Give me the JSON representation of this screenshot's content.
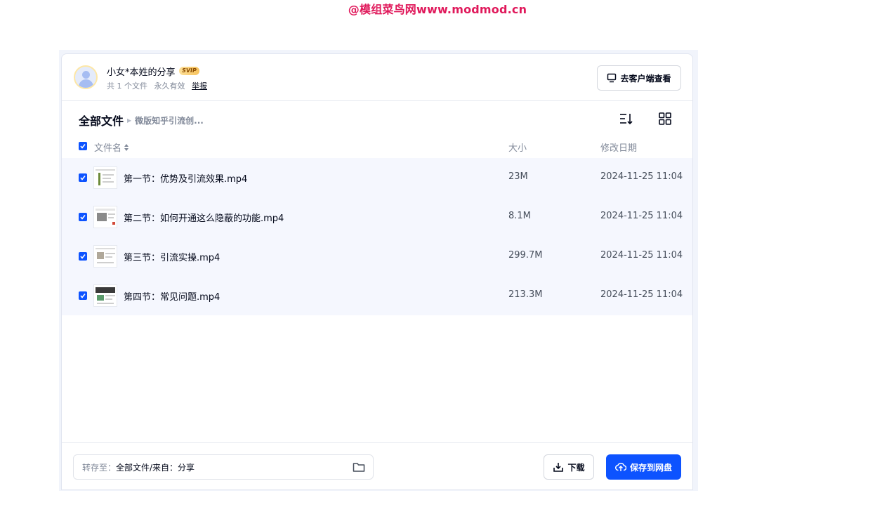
{
  "watermark": "@模组菜鸟网www.modmod.cn",
  "share": {
    "owner": "小女*本姓的分享",
    "badge": "SVIP",
    "file_count": "共 1 个文件",
    "validity": "永久有效",
    "report": "举报",
    "client_button": "去客户端查看"
  },
  "breadcrumb": {
    "root": "全部文件",
    "current": "微版知乎引流创..."
  },
  "columns": {
    "name": "文件名",
    "size": "大小",
    "date": "修改日期"
  },
  "files": [
    {
      "name": "第一节：优势及引流效果.mp4",
      "size": "23M",
      "date": "2024-11-25 11:04"
    },
    {
      "name": "第二节：如何开通这么隐蔽的功能.mp4",
      "size": "8.1M",
      "date": "2024-11-25 11:04"
    },
    {
      "name": "第三节：引流实操.mp4",
      "size": "299.7M",
      "date": "2024-11-25 11:04"
    },
    {
      "name": "第四节：常见问题.mp4",
      "size": "213.3M",
      "date": "2024-11-25 11:04"
    }
  ],
  "footer": {
    "save_to_label": "转存至：",
    "save_to_path": "全部文件/来自：分享",
    "download": "下载",
    "save": "保存到网盘"
  },
  "colors": {
    "accent": "#0d53ff",
    "watermark": "#e0195b",
    "row_bg": "#f5f7fe"
  }
}
